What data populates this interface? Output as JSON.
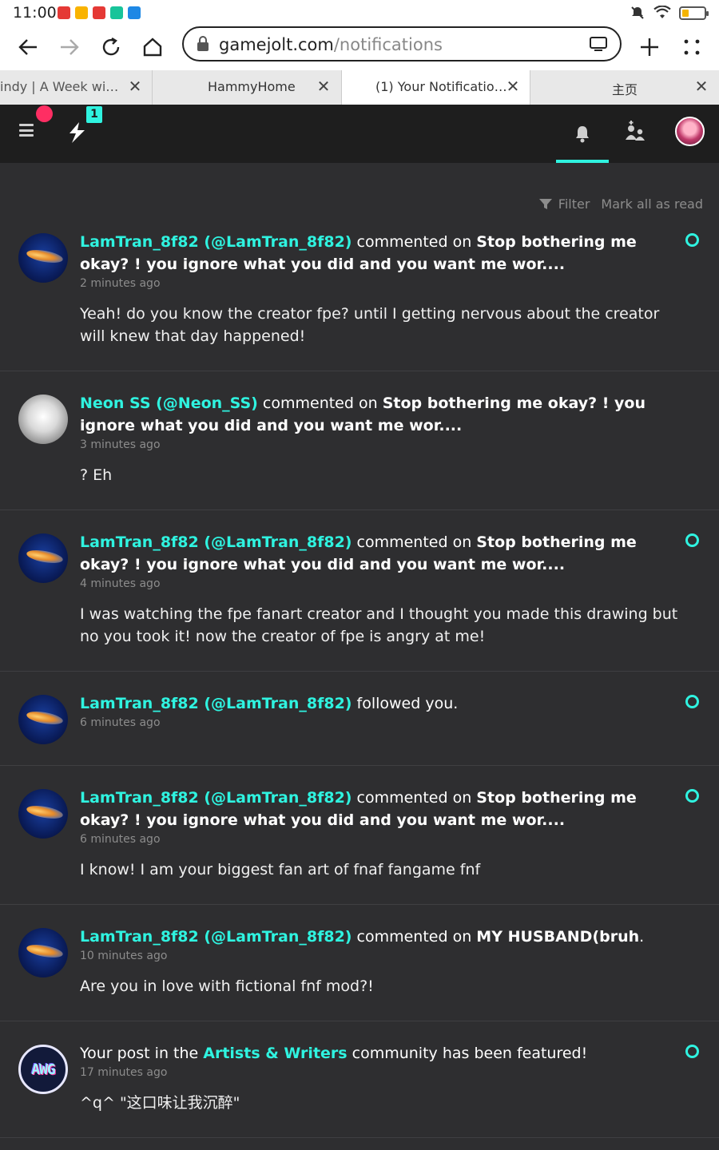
{
  "status_bar": {
    "time": "11:00"
  },
  "browser": {
    "url_domain": "gamejolt.com",
    "url_path": "/notifications",
    "tabs": [
      {
        "title": "indy | A Week wi…",
        "active": false
      },
      {
        "title": "HammyHome",
        "active": false
      },
      {
        "title": "(1) Your Notificatio…",
        "active": true
      },
      {
        "title": "主页",
        "active": false
      }
    ],
    "tab_close": "✕"
  },
  "header": {
    "notification_count": "1"
  },
  "filters": {
    "filter_label": "Filter",
    "mark_all_label": "Mark all as read"
  },
  "notifications": [
    {
      "user": "LamTran_8f82 (@LamTran_8f82)",
      "action": " commented on ",
      "target": "Stop bothering me okay? ! you ignore what you did and you want me wor....",
      "time": "2 minutes ago",
      "body": "Yeah! do you know the creator fpe? until I getting nervous about the creator will knew that day happened!",
      "unread": true,
      "avatar": "jellyfish-avatar"
    },
    {
      "user": "Neon SS (@Neon_SS)",
      "action": " commented on ",
      "target": "Stop bothering me okay? ! you ignore what you did and you want me wor....",
      "time": "3 minutes ago",
      "body": "? Eh",
      "unread": false,
      "avatar": "neon-avatar"
    },
    {
      "user": "LamTran_8f82 (@LamTran_8f82)",
      "action": " commented on ",
      "target": "Stop bothering me okay? ! you ignore what you did and you want me wor....",
      "time": "4 minutes ago",
      "body": "I was watching the fpe fanart creator and I thought you made this drawing but no you took it! now the creator of fpe is angry at me!",
      "unread": true,
      "avatar": "jellyfish-avatar"
    },
    {
      "user": "LamTran_8f82 (@LamTran_8f82)",
      "action": " followed you.",
      "target": "",
      "time": "6 minutes ago",
      "body": "",
      "unread": true,
      "avatar": "jellyfish-avatar"
    },
    {
      "user": "LamTran_8f82 (@LamTran_8f82)",
      "action": " commented on ",
      "target": "Stop bothering me okay? ! you ignore what you did and you want me wor....",
      "time": "6 minutes ago",
      "body": "I know! I am your biggest fan art of fnaf fangame fnf",
      "unread": true,
      "avatar": "jellyfish-avatar"
    },
    {
      "user": "LamTran_8f82 (@LamTran_8f82)",
      "action": " commented on ",
      "target": "MY HUSBAND(bruh",
      "target_suffix": ".",
      "time": "10 minutes ago",
      "body": "Are you in love with fictional fnf mod?!",
      "unread": false,
      "avatar": "jellyfish-avatar"
    },
    {
      "prefix": "Your post in the ",
      "community": "Artists & Writers",
      "suffix": " community has been featured!",
      "time": "17 minutes ago",
      "body": "^q^ \"这口味让我沉醉\"",
      "unread": true,
      "avatar": "artists-writers-avatar",
      "avatar_text": "AWG"
    }
  ]
}
